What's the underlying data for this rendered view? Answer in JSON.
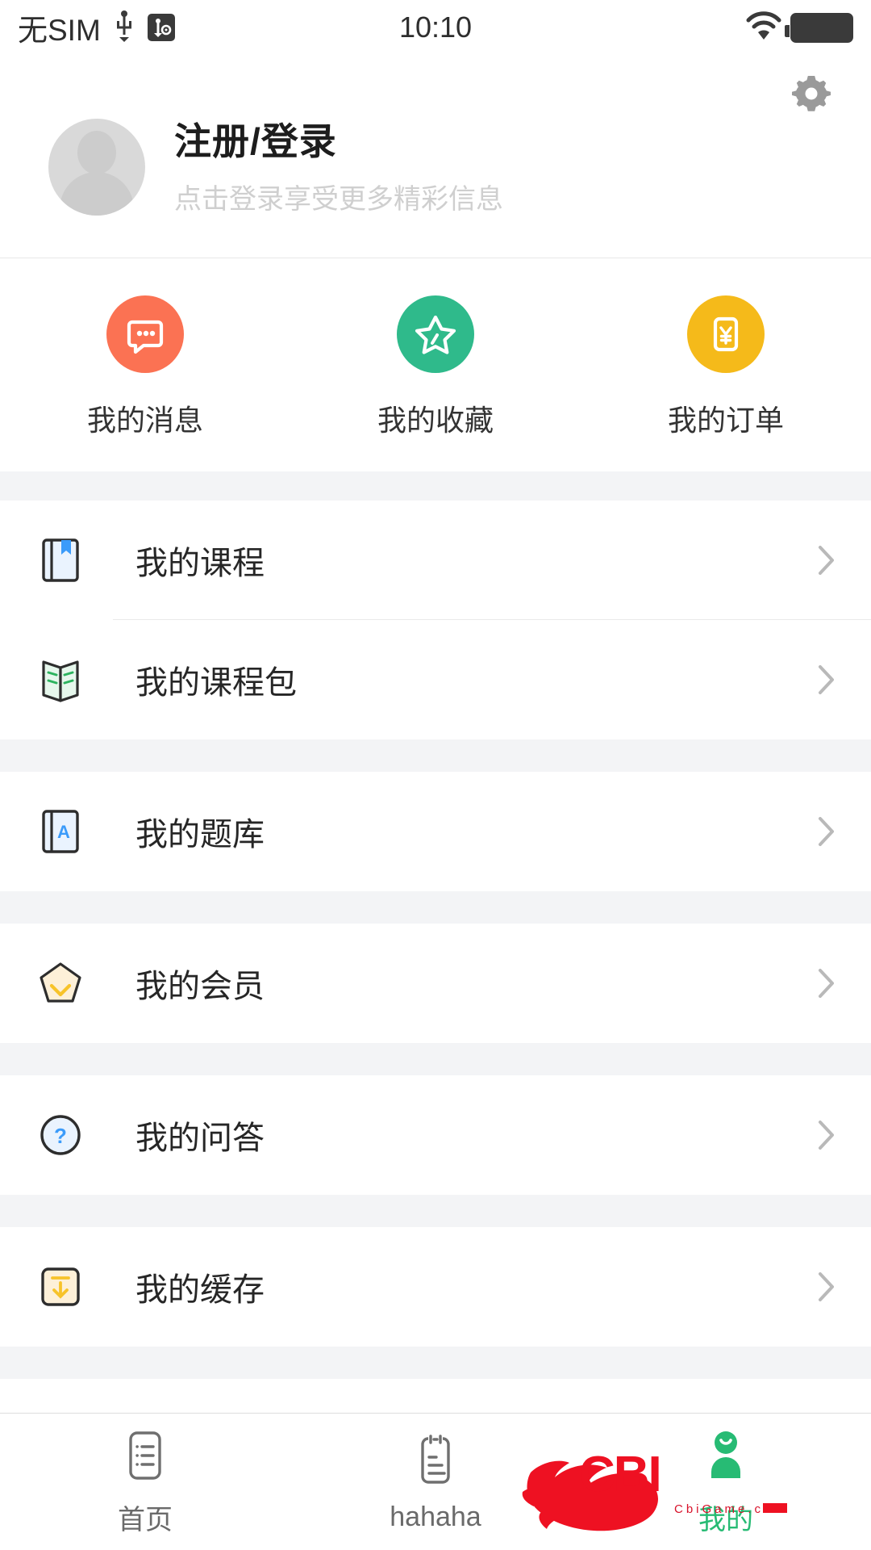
{
  "status_bar": {
    "carrier": "无SIM",
    "time": "10:10",
    "usb_icon": "usb-icon",
    "usb_debug_icon": "usb-debug-icon",
    "wifi_icon": "wifi-icon",
    "battery_icon": "battery-icon"
  },
  "header": {
    "settings_icon": "gear-icon",
    "avatar_icon": "avatar-placeholder-icon",
    "title": "注册/登录",
    "subtitle": "点击登录享受更多精彩信息"
  },
  "quick_actions": [
    {
      "label": "我的消息",
      "icon": "message-bubble-icon",
      "color": "#fb7253"
    },
    {
      "label": "我的收藏",
      "icon": "star-icon",
      "color": "#2fba8b"
    },
    {
      "label": "我的订单",
      "icon": "yen-card-icon",
      "color": "#f5ba1a"
    }
  ],
  "menu_groups": [
    {
      "items": [
        {
          "label": "我的课程",
          "icon": "bookmark-book-icon",
          "chevron": "chevron-right-icon"
        },
        {
          "label": "我的课程包",
          "icon": "open-book-icon",
          "chevron": "chevron-right-icon"
        }
      ]
    },
    {
      "items": [
        {
          "label": "我的题库",
          "icon": "question-bank-book-icon",
          "chevron": "chevron-right-icon"
        }
      ]
    },
    {
      "items": [
        {
          "label": "我的会员",
          "icon": "membership-pentagon-icon",
          "chevron": "chevron-right-icon"
        }
      ]
    },
    {
      "items": [
        {
          "label": "我的问答",
          "icon": "question-circle-icon",
          "chevron": "chevron-right-icon"
        }
      ]
    },
    {
      "items": [
        {
          "label": "我的缓存",
          "icon": "download-cache-icon",
          "chevron": "chevron-right-icon"
        }
      ]
    }
  ],
  "tabbar": {
    "active_color": "#27bb74",
    "inactive_color": "#6a6a6a",
    "tabs": [
      {
        "label": "首页",
        "icon": "list-page-icon",
        "active": false
      },
      {
        "label": "hahaha",
        "icon": "note-page-icon",
        "active": false
      },
      {
        "label": "我的",
        "icon": "person-icon",
        "active": true
      }
    ]
  },
  "watermark": {
    "logo_text": "CBI",
    "site_text": "CbiGame.com",
    "color": "#ee1122"
  }
}
